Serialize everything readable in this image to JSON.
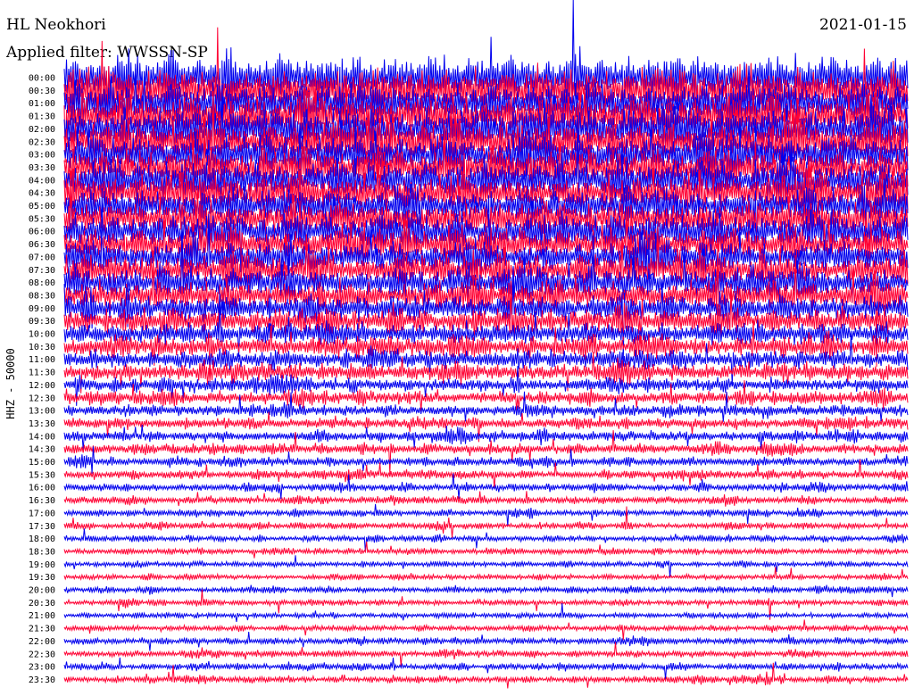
{
  "header": {
    "station": "HL Neokhori",
    "date": "2021-01-15",
    "filter": "Applied filter: WWSSN-SP"
  },
  "channel_label": "HHZ - 50000",
  "colors": {
    "trace_a": "#0000ee",
    "trace_b": "#ff0033"
  },
  "chart_data": {
    "type": "line",
    "subtype": "helicorder",
    "title": "HL Neokhori",
    "ylabel": "HHZ - 50000",
    "row_labels": [
      "00:00",
      "00:30",
      "01:00",
      "01:30",
      "02:00",
      "02:30",
      "03:00",
      "03:30",
      "04:00",
      "04:30",
      "05:00",
      "05:30",
      "06:00",
      "06:30",
      "07:00",
      "07:30",
      "08:00",
      "08:30",
      "09:00",
      "09:30",
      "10:00",
      "10:30",
      "11:00",
      "11:30",
      "12:00",
      "12:30",
      "13:00",
      "13:30",
      "14:00",
      "14:30",
      "15:00",
      "15:30",
      "16:00",
      "16:30",
      "17:00",
      "17:30",
      "18:00",
      "18:30",
      "19:00",
      "19:30",
      "20:00",
      "20:30",
      "21:00",
      "21:30",
      "22:00",
      "22:30",
      "23:00",
      "23:30"
    ],
    "row_colors_cycle": [
      "#0000ee",
      "#ff0033"
    ],
    "relative_amplitude": [
      3.2,
      3.2,
      3.0,
      3.0,
      2.9,
      2.8,
      2.8,
      2.7,
      2.7,
      2.6,
      2.5,
      2.5,
      2.4,
      2.3,
      2.3,
      2.2,
      2.1,
      2.0,
      1.9,
      1.8,
      1.6,
      1.5,
      1.4,
      1.3,
      1.1,
      1.0,
      0.9,
      0.85,
      0.8,
      0.75,
      0.7,
      0.65,
      0.6,
      0.55,
      0.5,
      0.5,
      0.45,
      0.45,
      0.4,
      0.4,
      0.45,
      0.45,
      0.4,
      0.45,
      0.5,
      0.5,
      0.5,
      0.5
    ],
    "grid": false,
    "legend": "none"
  }
}
